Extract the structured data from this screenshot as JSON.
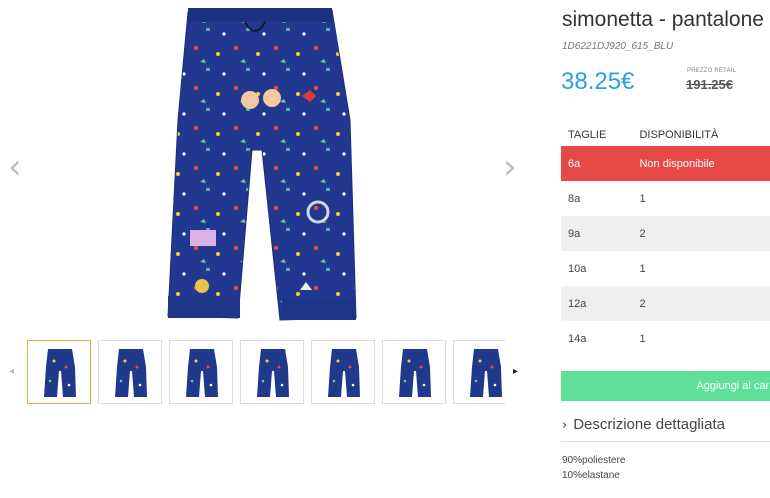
{
  "product": {
    "title": "simonetta - pantalone",
    "sku": "1D6221DJ920_615_BLU",
    "price": "38.25€",
    "retail_label": "PREZZO RETAIL",
    "retail_price": "191.25€"
  },
  "gallery": {
    "prev_icon": "chevron-left-icon",
    "next_icon": "chevron-right-icon",
    "thumb_count": 7,
    "active_thumb": 0
  },
  "sizes_table": {
    "headers": [
      "TAGLIE",
      "DISPONIBILITÀ"
    ],
    "rows": [
      {
        "size": "6a",
        "availability": "Non disponibile",
        "status": "unavailable"
      },
      {
        "size": "8a",
        "availability": "1"
      },
      {
        "size": "9a",
        "availability": "2"
      },
      {
        "size": "10a",
        "availability": "1"
      },
      {
        "size": "12a",
        "availability": "2"
      },
      {
        "size": "14a",
        "availability": "1"
      }
    ]
  },
  "cart": {
    "label": "Aggiungi al carrello"
  },
  "description": {
    "toggle_label": "Descrizione dettagliata",
    "materials": [
      "90%poliestere",
      "10%elastane"
    ]
  },
  "colors": {
    "accent_price": "#27a2e0",
    "unavailable_row": "#e74848",
    "add_to_cart": "#5fe09a",
    "active_thumb_border": "#f0a24d",
    "pants_blue": "#1f3a8a"
  }
}
